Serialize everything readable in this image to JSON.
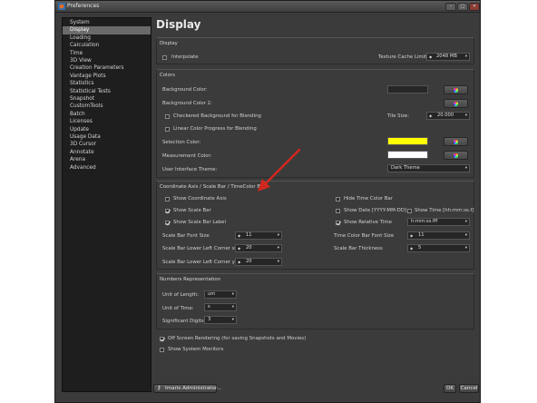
{
  "window": {
    "title": "Preferences",
    "wc_min": "–",
    "wc_max": "□",
    "wc_close": "✕"
  },
  "sidebar": {
    "items": [
      {
        "label": "System"
      },
      {
        "label": "Display"
      },
      {
        "label": "Loading"
      },
      {
        "label": "Calculation"
      },
      {
        "label": "Time"
      },
      {
        "label": "3D View"
      },
      {
        "label": "Creation Parameters"
      },
      {
        "label": "Vantage Plots"
      },
      {
        "label": "Statistics"
      },
      {
        "label": "Statistical Tests"
      },
      {
        "label": "Snapshot"
      },
      {
        "label": "CustomTools"
      },
      {
        "label": "Batch"
      },
      {
        "label": "Licenses"
      },
      {
        "label": "Update"
      },
      {
        "label": "Usage Data"
      },
      {
        "label": "3D Cursor"
      },
      {
        "label": "Annotate"
      },
      {
        "label": "Arena"
      },
      {
        "label": "Advanced"
      }
    ],
    "selected_index": 1
  },
  "page": {
    "heading": "Display"
  },
  "display": {
    "title": "Display",
    "interpolate": "Interpolate",
    "interpolate_checked": false,
    "tex_label": "Texture Cache Limit:",
    "tex_value": "2048 MB"
  },
  "colors": {
    "title": "Colors",
    "bg_label": "Background Color:",
    "bg_color": "#262626",
    "bg2_label": "Background Color 2:",
    "checkered": "Checkered Background for Blending",
    "checkered_checked": false,
    "linear": "Linear Color Progress for Blending",
    "linear_checked": false,
    "tile_label": "Tile Size:",
    "tile_value": "20.000",
    "sel_label": "Selection Color:",
    "sel_color": "#ffff00",
    "meas_label": "Measurement Color:",
    "meas_color": "#ffffff",
    "theme_label": "User Interface Theme:",
    "theme_value": "Dark Theme"
  },
  "coord": {
    "title": "Coordinate Axis / Scale Bar / TimeColor Bar",
    "show_axis": "Show Coordinate Axis",
    "show_axis_checked": false,
    "hide_time": "Hide Time Color Bar",
    "hide_time_checked": false,
    "show_scale": "Show Scale Bar",
    "show_scale_checked": true,
    "show_date": "Show Date [YYYY-MM-DD]",
    "show_date_checked": false,
    "show_time": "Show Time [hh:mm:ss.f]",
    "show_time_checked": false,
    "show_scale_label": "Show Scale Bar Label",
    "show_scale_label_checked": true,
    "show_rel": "Show Relative Time",
    "show_rel_checked": true,
    "rel_format": "h:mm:ss.fff",
    "sb_font_label": "Scale Bar Font Size",
    "sb_font_value": "11",
    "tc_font_label": "Time Color Bar Font Size",
    "tc_font_value": "11",
    "sb_llx_label": "Scale Bar Lower Left Corner x:",
    "sb_llx_value": "20",
    "sb_thick_label": "Scale Bar Thickness",
    "sb_thick_value": "5",
    "sb_lly_label": "Scale Bar Lower Left Corner y:",
    "sb_lly_value": "20"
  },
  "numbers": {
    "title": "Numbers Representation",
    "len_label": "Unit of Length:",
    "len_value": "um",
    "time_label": "Unit of Time:",
    "time_value": "s",
    "sig_label": "Significant Digits:",
    "sig_value": "3"
  },
  "misc": {
    "offscreen": "Off Screen Rendering (for saving Snapshots and Movies)",
    "offscreen_checked": true,
    "monitors": "Show System Monitors",
    "monitors_checked": false
  },
  "footer": {
    "user_button": "Imaris Administrator...",
    "ok": "OK",
    "cancel": "Cancel"
  },
  "annotation": {
    "arrow_color": "#d0281e"
  }
}
